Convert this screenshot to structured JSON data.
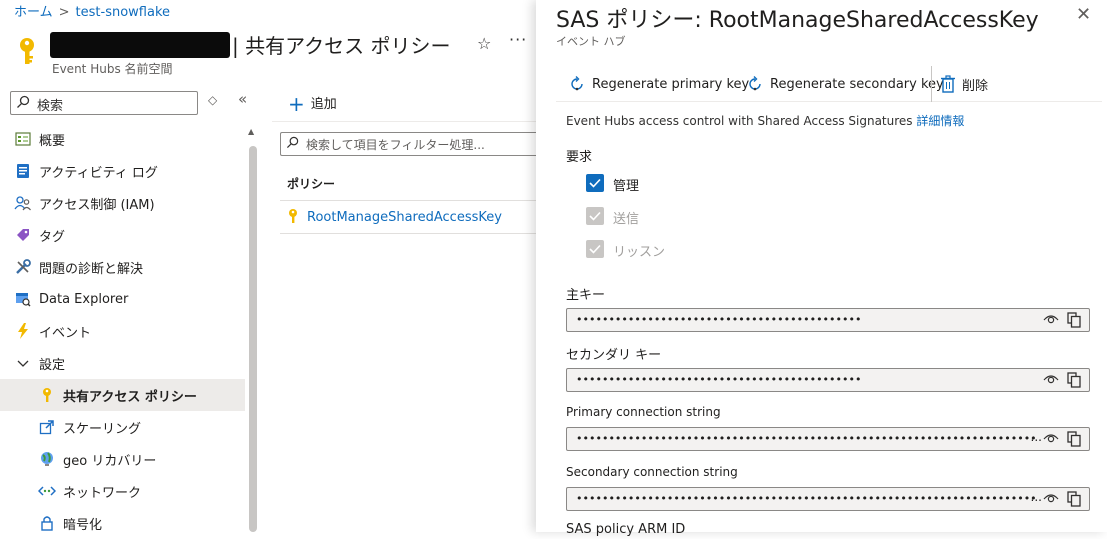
{
  "breadcrumb": {
    "home": "ホーム",
    "separator": ">",
    "resource": "test-snowflake"
  },
  "header": {
    "title": "| 共有アクセス ポリシー",
    "subtitle": "Event Hubs 名前空間",
    "favorite_icon": "star-icon",
    "more_icon": "more-icon"
  },
  "sidebar": {
    "search_placeholder": "検索",
    "items": [
      {
        "label": "概要",
        "icon": "overview-icon"
      },
      {
        "label": "アクティビティ ログ",
        "icon": "activity-log-icon"
      },
      {
        "label": "アクセス制御 (IAM)",
        "icon": "iam-icon"
      },
      {
        "label": "タグ",
        "icon": "tag-icon"
      },
      {
        "label": "問題の診断と解決",
        "icon": "wrench-icon"
      },
      {
        "label": "Data Explorer",
        "icon": "data-explorer-icon"
      },
      {
        "label": "イベント",
        "icon": "lightning-icon"
      },
      {
        "label": "設定",
        "icon": "chevron-down-icon"
      },
      {
        "label": "共有アクセス ポリシー",
        "icon": "key-icon"
      },
      {
        "label": "スケーリング",
        "icon": "scale-icon"
      },
      {
        "label": "geo リカバリー",
        "icon": "globe-icon"
      },
      {
        "label": "ネットワーク",
        "icon": "network-icon"
      },
      {
        "label": "暗号化",
        "icon": "lock-icon"
      }
    ]
  },
  "main": {
    "add_label": "追加",
    "filter_placeholder": "検索して項目をフィルター処理...",
    "column_header": "ポリシー",
    "rows": [
      {
        "name": "RootManageSharedAccessKey"
      }
    ]
  },
  "panel": {
    "title": "SAS ポリシー: RootManageSharedAccessKey",
    "subtitle": "イベント ハブ",
    "toolbar": {
      "regen_primary": "Regenerate primary key",
      "regen_secondary": "Regenerate secondary key",
      "delete": "削除"
    },
    "description": "Event Hubs access control with Shared Access Signatures",
    "learn_more": "詳細情報",
    "claims_label": "要求",
    "claims": [
      {
        "label": "管理",
        "checked": true,
        "disabled": false
      },
      {
        "label": "送信",
        "checked": true,
        "disabled": true
      },
      {
        "label": "リッスン",
        "checked": true,
        "disabled": true
      }
    ],
    "fields": {
      "primary_key": {
        "label": "主キー",
        "value": "••••••••••••••••••••••••••••••••••••••••••••"
      },
      "secondary_key": {
        "label": "セカンダリ キー",
        "value": "••••••••••••••••••••••••••••••••••••••••••••"
      },
      "primary_conn": {
        "label": "Primary connection string",
        "value": "•••••••••••••••••••••••••••••••••••••••••••••••••••••••••••••••••••••••••••••••••••",
        "ellipsis": "..."
      },
      "secondary_conn": {
        "label": "Secondary connection string",
        "value": "•••••••••••••••••••••••••••••••••••••••••••••••••••••••••••••••••••••••••••••••••••",
        "ellipsis": "..."
      }
    },
    "cut_label": "SAS policy ARM ID"
  },
  "colors": {
    "accent": "#0f6cbd",
    "key_gold": "#f2b900",
    "active_bg": "#edebe9"
  }
}
